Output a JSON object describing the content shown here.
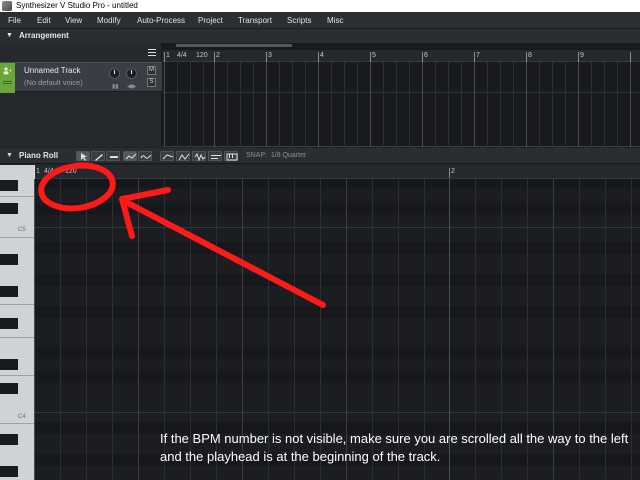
{
  "window": {
    "title": "Synthesizer V Studio Pro - untitled"
  },
  "menu": [
    "File",
    "Edit",
    "View",
    "Modify",
    "Auto-Process",
    "Project",
    "Transport",
    "Scripts",
    "Misc"
  ],
  "arrangement": {
    "header": "Arrangement",
    "ruler": {
      "bar1": "1",
      "time_signature": "4/4",
      "tempo": "120",
      "bars": [
        "2",
        "3",
        "4",
        "5",
        "6",
        "7",
        "8",
        "9"
      ]
    },
    "track": {
      "name": "Unnamed Track",
      "voice": "(No default voice)",
      "mute": "M",
      "solo": "S"
    }
  },
  "piano_roll": {
    "header": "Piano Roll",
    "snap_label": "SNAP:",
    "snap_value": "1/8 Quarter",
    "ruler": {
      "bar1": "1",
      "time_signature": "4/4",
      "tempo": "120",
      "bar2": "2"
    },
    "key_labels": [
      "C5",
      "C4"
    ]
  },
  "annotation": {
    "caption": "If the BPM number is not visible, make sure you are scrolled all the way to the left and the playhead is at the beginning of the track.",
    "color": "#ff1a1a"
  },
  "colors": {
    "track_accent": "#6aa63a",
    "background": "#1b1d20"
  }
}
